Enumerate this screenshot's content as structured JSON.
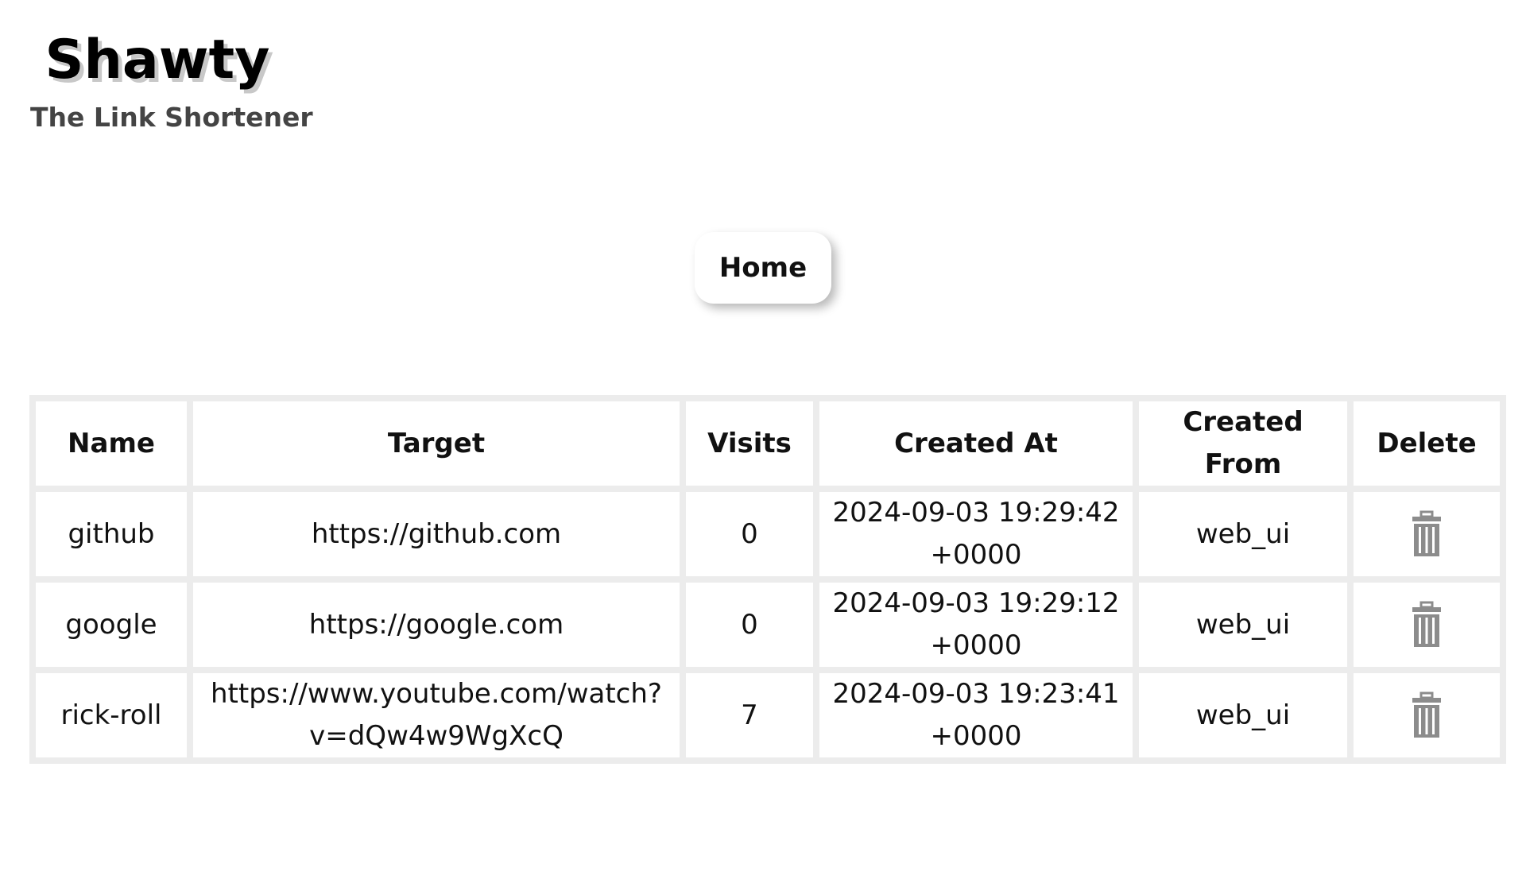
{
  "brand": {
    "title": "Shawty",
    "subtitle": "The Link Shortener"
  },
  "nav": {
    "home_label": "Home"
  },
  "table": {
    "headers": [
      "Name",
      "Target",
      "Visits",
      "Created At",
      "Created From",
      "Delete"
    ],
    "rows": [
      {
        "name": "github",
        "target": "https://github.com",
        "visits": "0",
        "created_at": "2024-09-03 19:29:42 +0000",
        "created_from": "web_ui",
        "delete_icon": "trash-icon"
      },
      {
        "name": "google",
        "target": "https://google.com",
        "visits": "0",
        "created_at": "2024-09-03 19:29:12 +0000",
        "created_from": "web_ui",
        "delete_icon": "trash-icon"
      },
      {
        "name": "rick-roll",
        "target": "https://www.youtube.com/watch?v=dQw4w9WgXcQ",
        "visits": "7",
        "created_at": "2024-09-03 19:23:41 +0000",
        "created_from": "web_ui",
        "delete_icon": "trash-icon"
      }
    ]
  },
  "colors": {
    "background": "#ffffff",
    "table_border": "#ececec",
    "subtitle": "#444444",
    "title_shadow": "#c8c8c8",
    "icon": "#8c8c8c"
  }
}
